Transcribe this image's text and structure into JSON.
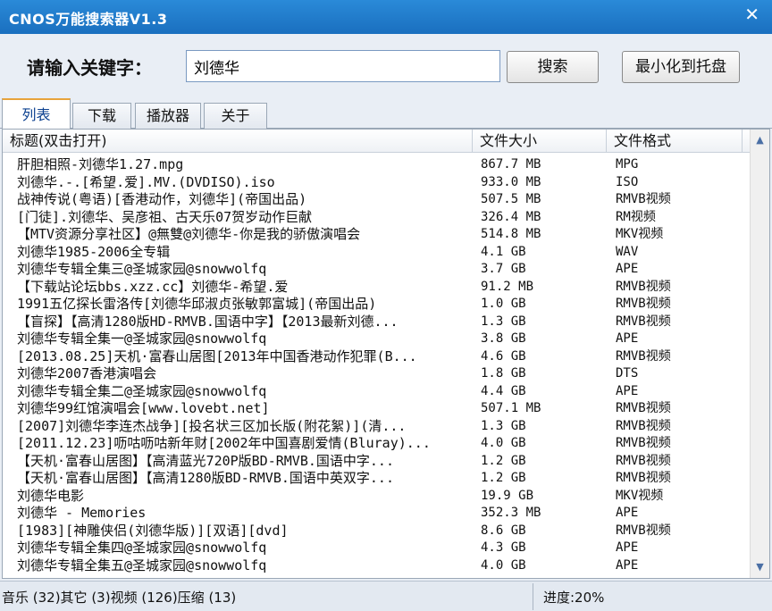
{
  "window": {
    "title": "CNOS万能搜索器V1.3",
    "close_glyph": "✕"
  },
  "search": {
    "label": "请输入关键字：",
    "value": "刘德华",
    "search_button": "搜索",
    "minimize_button": "最小化到托盘"
  },
  "tabs": [
    {
      "label": "列表",
      "active": true
    },
    {
      "label": "下载"
    },
    {
      "label": "播放器"
    },
    {
      "label": "关于"
    }
  ],
  "columns": {
    "title": "标题(双击打开)",
    "size": "文件大小",
    "format": "文件格式"
  },
  "rows": [
    {
      "title": "肝胆相照-刘德华1.27.mpg",
      "size": "867.7 MB",
      "format": "MPG"
    },
    {
      "title": "刘德华.-.[希望.爱].MV.(DVDISO).iso",
      "size": "933.0 MB",
      "format": "ISO"
    },
    {
      "title": "战神传说(粤语)[香港动作，刘德华](帝国出品)",
      "size": "507.5 MB",
      "format": "RMVB视频"
    },
    {
      "title": "[门徒].刘德华、吴彦祖、古天乐07贺岁动作巨献",
      "size": "326.4 MB",
      "format": "RM视频"
    },
    {
      "title": "【MTV资源分享社区】@無雙@刘德华-你是我的骄傲演唱会",
      "size": "514.8 MB",
      "format": "MKV视频"
    },
    {
      "title": "刘德华1985-2006全专辑",
      "size": "4.1 GB",
      "format": "WAV"
    },
    {
      "title": "刘德华专辑全集三@圣城家园@snowwolfq",
      "size": "3.7 GB",
      "format": "APE"
    },
    {
      "title": "【下载站论坛bbs.xzz.cc】刘德华-希望.爱",
      "size": "91.2 MB",
      "format": "RMVB视频"
    },
    {
      "title": "1991五亿探长雷洛传[刘德华邱淑贞张敏郭富城](帝国出品)",
      "size": "1.0 GB",
      "format": "RMVB视频"
    },
    {
      "title": "【盲探】【高清1280版HD-RMVB.国语中字】【2013最新刘德...",
      "size": "1.3 GB",
      "format": "RMVB视频"
    },
    {
      "title": "刘德华专辑全集一@圣城家园@snowwolfq",
      "size": "3.8 GB",
      "format": "APE"
    },
    {
      "title": "[2013.08.25]天机·富春山居图[2013年中国香港动作犯罪(B...",
      "size": "4.6 GB",
      "format": "RMVB视频"
    },
    {
      "title": "刘德华2007香港演唱会",
      "size": "1.8 GB",
      "format": "DTS"
    },
    {
      "title": "刘德华专辑全集二@圣城家园@snowwolfq",
      "size": "4.4 GB",
      "format": "APE"
    },
    {
      "title": "刘德华99红馆演唱会[www.lovebt.net]",
      "size": "507.1 MB",
      "format": "RMVB视频"
    },
    {
      "title": "[2007]刘德华李连杰战争][投名状三区加长版(附花絮)](清...",
      "size": "1.3 GB",
      "format": "RMVB视频"
    },
    {
      "title": "[2011.12.23]呖咕呖咕新年财[2002年中国喜剧爱情(Bluray)...",
      "size": "4.0 GB",
      "format": "RMVB视频"
    },
    {
      "title": "【天机·富春山居图】【高清蓝光720P版BD-RMVB.国语中字...",
      "size": "1.2 GB",
      "format": "RMVB视频"
    },
    {
      "title": "【天机·富春山居图】【高清1280版BD-RMVB.国语中英双字...",
      "size": "1.2 GB",
      "format": "RMVB视频"
    },
    {
      "title": "刘德华电影",
      "size": "19.9 GB",
      "format": "MKV视频"
    },
    {
      "title": "刘德华 - Memories",
      "size": "352.3 MB",
      "format": "APE"
    },
    {
      "title": "[1983][神雕侠侣(刘德华版)][双语][dvd]",
      "size": "8.6 GB",
      "format": "RMVB视频"
    },
    {
      "title": "刘德华专辑全集四@圣城家园@snowwolfq",
      "size": "4.3 GB",
      "format": "APE"
    },
    {
      "title": "刘德华专辑全集五@圣城家园@snowwolfq",
      "size": "4.0 GB",
      "format": "APE"
    }
  ],
  "status": {
    "left": "音乐 (32)其它 (3)视频 (126)压缩 (13)",
    "right": "进度:20%"
  },
  "scroll": {
    "up_glyph": "▲",
    "down_glyph": "▼"
  }
}
